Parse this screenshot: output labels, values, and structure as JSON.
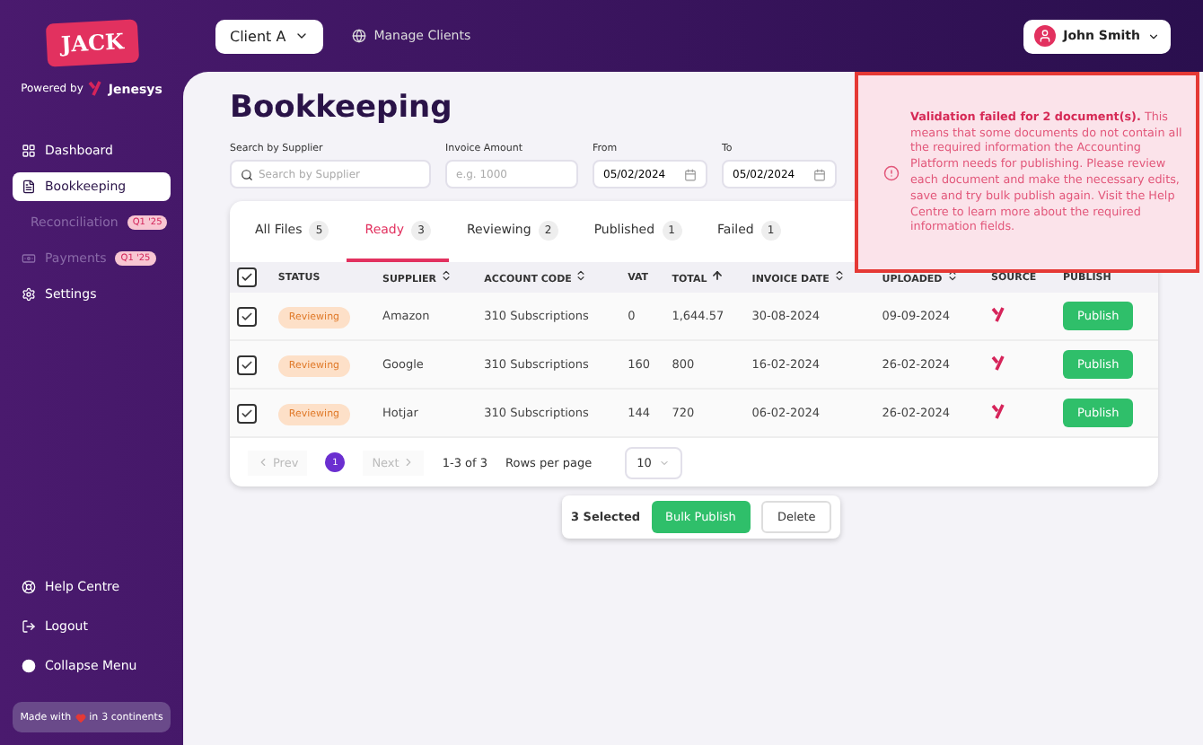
{
  "sidebar": {
    "logo": "JACK",
    "powered_by": "Powered by",
    "brand": "Jenesys",
    "items": [
      {
        "kind": "dashboard",
        "label": "Dashboard",
        "selected": false,
        "disabled": false
      },
      {
        "kind": "book",
        "label": "Bookkeeping",
        "selected": true,
        "disabled": false
      },
      {
        "kind": "reconcile",
        "label": "Reconciliation",
        "selected": false,
        "disabled": true,
        "badge": "Q1 '25"
      },
      {
        "kind": "payments",
        "label": "Payments",
        "selected": false,
        "disabled": true,
        "badge": "Q1 '25"
      },
      {
        "kind": "settings",
        "label": "Settings",
        "selected": false,
        "disabled": false
      }
    ],
    "bottom_items": [
      {
        "kind": "help",
        "label": "Help Centre"
      },
      {
        "kind": "logout",
        "label": "Logout"
      },
      {
        "kind": "collapse",
        "label": "Collapse Menu"
      }
    ],
    "footer": {
      "before": "Made with",
      "after": "in",
      "place": "3 continents"
    }
  },
  "header": {
    "client": "Client A",
    "manage": "Manage Clients",
    "user": "John Smith"
  },
  "page": {
    "title": "Bookkeeping",
    "filters": [
      {
        "kind": "search",
        "label": "Search by Supplier",
        "placeholder": "Search by Supplier"
      },
      {
        "kind": "text",
        "label": "Invoice Amount",
        "placeholder": "e.g. 1000"
      },
      {
        "kind": "date",
        "label": "From",
        "value": "05/02/2024"
      },
      {
        "kind": "date",
        "label": "To",
        "value": "05/02/2024"
      }
    ],
    "tabs": [
      {
        "label": "All Files",
        "count": "5",
        "selected": false
      },
      {
        "label": "Ready",
        "count": "3",
        "selected": true
      },
      {
        "label": "Reviewing",
        "count": "2",
        "selected": false
      },
      {
        "label": "Published",
        "count": "1",
        "selected": false
      },
      {
        "label": "Failed",
        "count": "1",
        "selected": false
      }
    ],
    "table": {
      "header_checked": true,
      "columns": [
        {
          "label": "STATUS",
          "sortable": false,
          "sorted": false
        },
        {
          "label": "SUPPLIER",
          "sortable": true,
          "sorted": false
        },
        {
          "label": "ACCOUNT CODE",
          "sortable": true,
          "sorted": false
        },
        {
          "label": "VAT",
          "sortable": false,
          "sorted": false
        },
        {
          "label": "TOTAL",
          "sortable": true,
          "sorted": true
        },
        {
          "label": "INVOICE DATE",
          "sortable": true,
          "sorted": false
        },
        {
          "label": "UPLOADED",
          "sortable": true,
          "sorted": false
        },
        {
          "label": "SOURCE",
          "sortable": false,
          "sorted": false
        },
        {
          "label": "PUBLISH",
          "sortable": false,
          "sorted": false
        }
      ],
      "rows": [
        {
          "checked": true,
          "status": "Reviewing",
          "supplier": "Amazon",
          "account_code": "310 Subscriptions",
          "vat": "0",
          "total": "1,644.57",
          "invoice_date": "30-08-2024",
          "uploaded": "09-09-2024",
          "action": "Publish"
        },
        {
          "checked": true,
          "status": "Reviewing",
          "supplier": "Google",
          "account_code": "310 Subscriptions",
          "vat": "160",
          "total": "800",
          "invoice_date": "16-02-2024",
          "uploaded": "26-02-2024",
          "action": "Publish"
        },
        {
          "checked": true,
          "status": "Reviewing",
          "supplier": "Hotjar",
          "account_code": "310 Subscriptions",
          "vat": "144",
          "total": "720",
          "invoice_date": "06-02-2024",
          "uploaded": "26-02-2024",
          "action": "Publish"
        }
      ]
    },
    "pagination": {
      "prev": "Prev",
      "page": "1",
      "next": "Next",
      "range": "1-3 of 3",
      "rows_label": "Rows per page",
      "rows_value": "10"
    },
    "bulk": {
      "selected": "3 Selected",
      "publish": "Bulk Publish",
      "delete": "Delete"
    }
  },
  "alert": {
    "title": "Validation failed for 2 document(s).",
    "body": "This means that some documents do not contain all the required information the Accounting Platform needs for publishing. Please review each document and make the necessary edits, save and try bulk publish again. Visit the Help Centre to learn more about the required information fields."
  }
}
